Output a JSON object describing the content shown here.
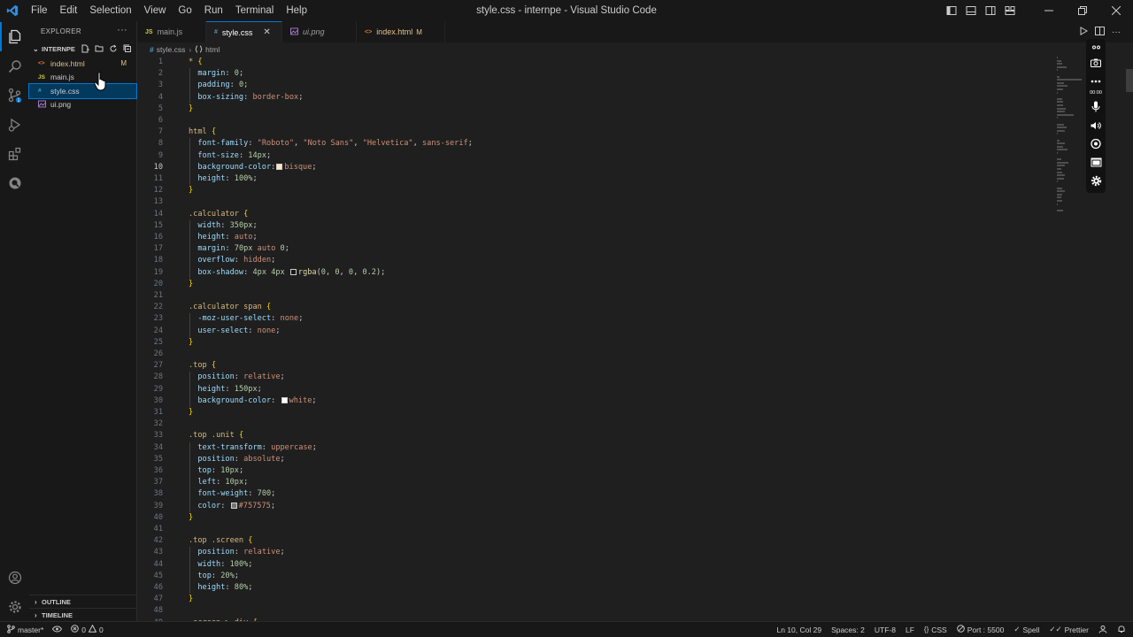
{
  "titlebar": {
    "menu": [
      "File",
      "Edit",
      "Selection",
      "View",
      "Go",
      "Run",
      "Terminal",
      "Help"
    ],
    "title": "style.css - internpe - Visual Studio Code",
    "window_controls": [
      "minimize-icon",
      "restore-icon",
      "close-icon"
    ]
  },
  "sidebar": {
    "title": "EXPLORER",
    "more": "···",
    "folder": "INTERNPE",
    "files": [
      {
        "type": "<>",
        "name": "index.html",
        "status": "M",
        "modified": true
      },
      {
        "type": "JS",
        "name": "main.js",
        "status": ""
      },
      {
        "type": "#",
        "name": "style.css",
        "status": "",
        "selected": true
      },
      {
        "type": "img",
        "name": "ui.png",
        "status": ""
      }
    ],
    "outline": "OUTLINE",
    "timeline": "TIMELINE"
  },
  "tabs": [
    {
      "type": "JS",
      "label": "main.js"
    },
    {
      "type": "#",
      "label": "style.css",
      "active": true
    },
    {
      "type": "img",
      "label": "ui.png",
      "italic": true
    },
    {
      "type": "<>",
      "label": "index.html",
      "mark": "M",
      "modified": true
    }
  ],
  "breadcrumb": {
    "file": "style.css",
    "symbol": "html"
  },
  "editor": {
    "current_line": 10,
    "lines": [
      [
        [
          "t-sel",
          "*"
        ],
        [
          "t-punc",
          " "
        ],
        [
          "t-brace",
          "{"
        ]
      ],
      [
        [
          "t-punc",
          "  "
        ],
        [
          "t-prop",
          "margin"
        ],
        [
          "t-punc",
          ": "
        ],
        [
          "t-num",
          "0"
        ],
        [
          "t-punc",
          ";"
        ]
      ],
      [
        [
          "t-punc",
          "  "
        ],
        [
          "t-prop",
          "padding"
        ],
        [
          "t-punc",
          ": "
        ],
        [
          "t-num",
          "0"
        ],
        [
          "t-punc",
          ";"
        ]
      ],
      [
        [
          "t-punc",
          "  "
        ],
        [
          "t-prop",
          "box-sizing"
        ],
        [
          "t-punc",
          ": "
        ],
        [
          "t-val",
          "border-box"
        ],
        [
          "t-punc",
          ";"
        ]
      ],
      [
        [
          "t-brace",
          "}"
        ]
      ],
      [],
      [
        [
          "t-tag",
          "html"
        ],
        [
          "t-punc",
          " "
        ],
        [
          "t-brace",
          "{"
        ]
      ],
      [
        [
          "t-punc",
          "  "
        ],
        [
          "t-prop",
          "font-family"
        ],
        [
          "t-punc",
          ": "
        ],
        [
          "t-str",
          "\"Roboto\""
        ],
        [
          "t-punc",
          ", "
        ],
        [
          "t-str",
          "\"Noto Sans\""
        ],
        [
          "t-punc",
          ", "
        ],
        [
          "t-str",
          "\"Helvetica\""
        ],
        [
          "t-punc",
          ", "
        ],
        [
          "t-val",
          "sans-serif"
        ],
        [
          "t-punc",
          ";"
        ]
      ],
      [
        [
          "t-punc",
          "  "
        ],
        [
          "t-prop",
          "font-size"
        ],
        [
          "t-punc",
          ": "
        ],
        [
          "t-num",
          "14px"
        ],
        [
          "t-punc",
          ";"
        ]
      ],
      [
        [
          "t-punc",
          "  "
        ],
        [
          "t-prop",
          "background-color"
        ],
        [
          "t-punc",
          ":"
        ],
        [
          "swatch",
          "#ffe4c4"
        ],
        [
          "t-val",
          "bisque"
        ],
        [
          "t-punc",
          ";"
        ]
      ],
      [
        [
          "t-punc",
          "  "
        ],
        [
          "t-prop",
          "height"
        ],
        [
          "t-punc",
          ": "
        ],
        [
          "t-num",
          "100%"
        ],
        [
          "t-punc",
          ";"
        ]
      ],
      [
        [
          "t-brace",
          "}"
        ]
      ],
      [],
      [
        [
          "t-sel",
          ".calculator"
        ],
        [
          "t-punc",
          " "
        ],
        [
          "t-brace",
          "{"
        ]
      ],
      [
        [
          "t-punc",
          "  "
        ],
        [
          "t-prop",
          "width"
        ],
        [
          "t-punc",
          ": "
        ],
        [
          "t-num",
          "350px"
        ],
        [
          "t-punc",
          ";"
        ]
      ],
      [
        [
          "t-punc",
          "  "
        ],
        [
          "t-prop",
          "height"
        ],
        [
          "t-punc",
          ": "
        ],
        [
          "t-val",
          "auto"
        ],
        [
          "t-punc",
          ";"
        ]
      ],
      [
        [
          "t-punc",
          "  "
        ],
        [
          "t-prop",
          "margin"
        ],
        [
          "t-punc",
          ": "
        ],
        [
          "t-num",
          "70px"
        ],
        [
          "t-punc",
          " "
        ],
        [
          "t-val",
          "auto"
        ],
        [
          "t-punc",
          " "
        ],
        [
          "t-num",
          "0"
        ],
        [
          "t-punc",
          ";"
        ]
      ],
      [
        [
          "t-punc",
          "  "
        ],
        [
          "t-prop",
          "overflow"
        ],
        [
          "t-punc",
          ": "
        ],
        [
          "t-val",
          "hidden"
        ],
        [
          "t-punc",
          ";"
        ]
      ],
      [
        [
          "t-punc",
          "  "
        ],
        [
          "t-prop",
          "box-shadow"
        ],
        [
          "t-punc",
          ": "
        ],
        [
          "t-num",
          "4px"
        ],
        [
          "t-punc",
          " "
        ],
        [
          "t-num",
          "4px"
        ],
        [
          "t-punc",
          " "
        ],
        [
          "swatch",
          "rgba(0,0,0,0.2)"
        ],
        [
          "t-fn",
          "rgba"
        ],
        [
          "t-punc",
          "("
        ],
        [
          "t-num",
          "0"
        ],
        [
          "t-punc",
          ", "
        ],
        [
          "t-num",
          "0"
        ],
        [
          "t-punc",
          ", "
        ],
        [
          "t-num",
          "0"
        ],
        [
          "t-punc",
          ", "
        ],
        [
          "t-num",
          "0.2"
        ],
        [
          "t-punc",
          ");"
        ]
      ],
      [
        [
          "t-brace",
          "}"
        ]
      ],
      [],
      [
        [
          "t-sel",
          ".calculator"
        ],
        [
          "t-punc",
          " "
        ],
        [
          "t-tag",
          "span"
        ],
        [
          "t-punc",
          " "
        ],
        [
          "t-brace",
          "{"
        ]
      ],
      [
        [
          "t-punc",
          "  "
        ],
        [
          "t-prop",
          "-moz-user-select"
        ],
        [
          "t-punc",
          ": "
        ],
        [
          "t-val",
          "none"
        ],
        [
          "t-punc",
          ";"
        ]
      ],
      [
        [
          "t-punc",
          "  "
        ],
        [
          "t-prop",
          "user-select"
        ],
        [
          "t-punc",
          ": "
        ],
        [
          "t-val",
          "none"
        ],
        [
          "t-punc",
          ";"
        ]
      ],
      [
        [
          "t-brace",
          "}"
        ]
      ],
      [],
      [
        [
          "t-sel",
          ".top"
        ],
        [
          "t-punc",
          " "
        ],
        [
          "t-brace",
          "{"
        ]
      ],
      [
        [
          "t-punc",
          "  "
        ],
        [
          "t-prop",
          "position"
        ],
        [
          "t-punc",
          ": "
        ],
        [
          "t-val",
          "relative"
        ],
        [
          "t-punc",
          ";"
        ]
      ],
      [
        [
          "t-punc",
          "  "
        ],
        [
          "t-prop",
          "height"
        ],
        [
          "t-punc",
          ": "
        ],
        [
          "t-num",
          "150px"
        ],
        [
          "t-punc",
          ";"
        ]
      ],
      [
        [
          "t-punc",
          "  "
        ],
        [
          "t-prop",
          "background-color"
        ],
        [
          "t-punc",
          ": "
        ],
        [
          "swatch",
          "#ffffff"
        ],
        [
          "t-val",
          "white"
        ],
        [
          "t-punc",
          ";"
        ]
      ],
      [
        [
          "t-brace",
          "}"
        ]
      ],
      [],
      [
        [
          "t-sel",
          ".top"
        ],
        [
          "t-punc",
          " "
        ],
        [
          "t-sel",
          ".unit"
        ],
        [
          "t-punc",
          " "
        ],
        [
          "t-brace",
          "{"
        ]
      ],
      [
        [
          "t-punc",
          "  "
        ],
        [
          "t-prop",
          "text-transform"
        ],
        [
          "t-punc",
          ": "
        ],
        [
          "t-val",
          "uppercase"
        ],
        [
          "t-punc",
          ";"
        ]
      ],
      [
        [
          "t-punc",
          "  "
        ],
        [
          "t-prop",
          "position"
        ],
        [
          "t-punc",
          ": "
        ],
        [
          "t-val",
          "absolute"
        ],
        [
          "t-punc",
          ";"
        ]
      ],
      [
        [
          "t-punc",
          "  "
        ],
        [
          "t-prop",
          "top"
        ],
        [
          "t-punc",
          ": "
        ],
        [
          "t-num",
          "10px"
        ],
        [
          "t-punc",
          ";"
        ]
      ],
      [
        [
          "t-punc",
          "  "
        ],
        [
          "t-prop",
          "left"
        ],
        [
          "t-punc",
          ": "
        ],
        [
          "t-num",
          "10px"
        ],
        [
          "t-punc",
          ";"
        ]
      ],
      [
        [
          "t-punc",
          "  "
        ],
        [
          "t-prop",
          "font-weight"
        ],
        [
          "t-punc",
          ": "
        ],
        [
          "t-num",
          "700"
        ],
        [
          "t-punc",
          ";"
        ]
      ],
      [
        [
          "t-punc",
          "  "
        ],
        [
          "t-prop",
          "color"
        ],
        [
          "t-punc",
          ": "
        ],
        [
          "swatch",
          "#757575"
        ],
        [
          "t-val",
          "#757575"
        ],
        [
          "t-punc",
          ";"
        ]
      ],
      [
        [
          "t-brace",
          "}"
        ]
      ],
      [],
      [
        [
          "t-sel",
          ".top"
        ],
        [
          "t-punc",
          " "
        ],
        [
          "t-sel",
          ".screen"
        ],
        [
          "t-punc",
          " "
        ],
        [
          "t-brace",
          "{"
        ]
      ],
      [
        [
          "t-punc",
          "  "
        ],
        [
          "t-prop",
          "position"
        ],
        [
          "t-punc",
          ": "
        ],
        [
          "t-val",
          "relative"
        ],
        [
          "t-punc",
          ";"
        ]
      ],
      [
        [
          "t-punc",
          "  "
        ],
        [
          "t-prop",
          "width"
        ],
        [
          "t-punc",
          ": "
        ],
        [
          "t-num",
          "100%"
        ],
        [
          "t-punc",
          ";"
        ]
      ],
      [
        [
          "t-punc",
          "  "
        ],
        [
          "t-prop",
          "top"
        ],
        [
          "t-punc",
          ": "
        ],
        [
          "t-num",
          "20%"
        ],
        [
          "t-punc",
          ";"
        ]
      ],
      [
        [
          "t-punc",
          "  "
        ],
        [
          "t-prop",
          "height"
        ],
        [
          "t-punc",
          ": "
        ],
        [
          "t-num",
          "80%"
        ],
        [
          "t-punc",
          ";"
        ]
      ],
      [
        [
          "t-brace",
          "}"
        ]
      ],
      [],
      [
        [
          "t-sel",
          ".screen"
        ],
        [
          "t-punc",
          " > "
        ],
        [
          "t-tag",
          "div"
        ],
        [
          "t-punc",
          " "
        ],
        [
          "t-brace",
          "{"
        ]
      ]
    ]
  },
  "recorder": {
    "time": "00:00"
  },
  "statusbar": {
    "branch": "master*",
    "errors": "0",
    "warnings": "0",
    "position": "Ln 10, Col 29",
    "spaces": "Spaces: 2",
    "encoding": "UTF-8",
    "eol": "LF",
    "language": "CSS",
    "port": "Port : 5500",
    "spell": "Spell",
    "prettier": "Prettier"
  },
  "colors": {
    "accent": "#0078d4",
    "modified": "#e2c08d",
    "editor_bg": "#1f1f1f",
    "chrome_bg": "#181818"
  }
}
